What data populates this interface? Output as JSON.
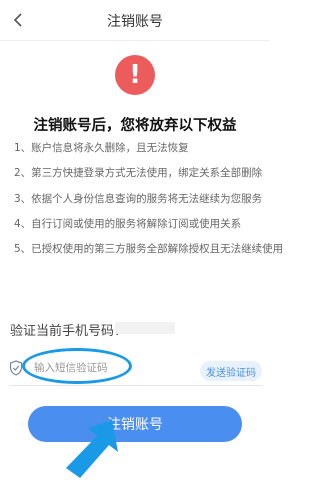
{
  "header": {
    "back_icon": "chevron-left-icon",
    "title": "注销账号"
  },
  "warning": {
    "icon": "exclamation-icon",
    "symbol": "!",
    "color": "#ed5c5c",
    "headline": "注销账号后，您将放弃以下权益"
  },
  "rights": [
    "1、账户信息将永久删除，且无法恢复",
    "2、第三方快捷登录方式无法使用，绑定关系全部删除",
    "3、依据个人身份信息查询的服务将无法继续为您服务",
    "4、自行订阅或使用的服务将解除订阅或使用关系",
    "5、已授权使用的第三方服务全部解除授权且无法继续使用"
  ],
  "verify": {
    "label": "验证当前手机号码：",
    "shield_icon": "shield-check-icon",
    "code_placeholder": "输入短信验证码",
    "send_code_label": "发送验证码"
  },
  "submit": {
    "label": "注销账号",
    "color": "#4a8ef0"
  },
  "annotation": {
    "color": "#1a9ae6"
  }
}
